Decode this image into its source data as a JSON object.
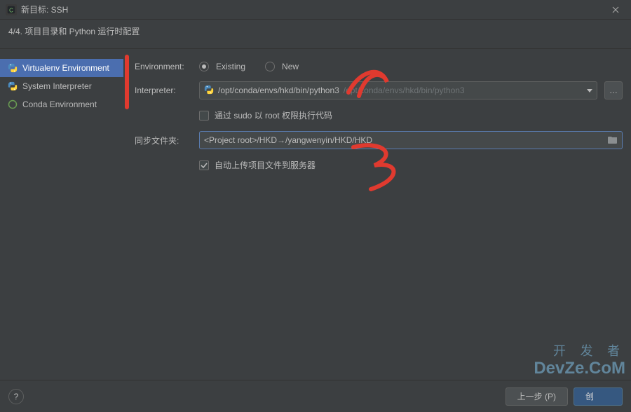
{
  "titlebar": {
    "title": "新目标: SSH"
  },
  "subtitle": "4/4. 项目目录和 Python 运行时配置",
  "sidebar": {
    "items": [
      {
        "label": "Virtualenv Environment"
      },
      {
        "label": "System Interpreter"
      },
      {
        "label": "Conda Environment"
      }
    ]
  },
  "form": {
    "environment_label": "Environment:",
    "existing_label": "Existing",
    "new_label": "New",
    "interpreter_label": "Interpreter:",
    "interpreter_value": "/opt/conda/envs/hkd/bin/python3",
    "interpreter_hint": "/opt/conda/envs/hkd/bin/python3",
    "sudo_label": "通过 sudo 以 root 权限执行代码",
    "sync_label": "同步文件夹:",
    "sync_value": "<Project root>/HKD→/yangwenyin/HKD/HKD",
    "auto_upload_label": "自动上传项目文件到服务器"
  },
  "footer": {
    "prev": "上一步 (P)",
    "create": "创"
  },
  "watermark": {
    "line1": "开 发 者",
    "line2": "DevZe.CoM"
  }
}
